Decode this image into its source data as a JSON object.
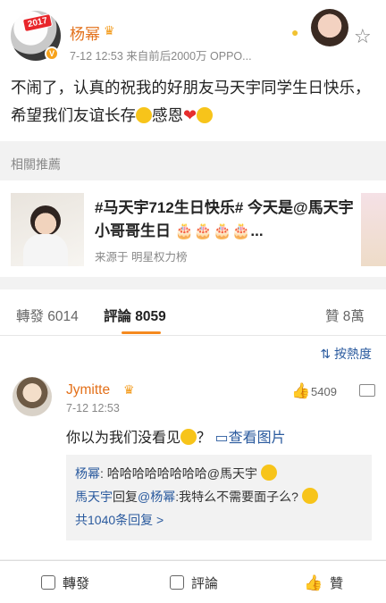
{
  "post": {
    "badge": "2017",
    "author": "杨幂",
    "meta": "7-12 12:53  来自前后2000万 OPPO...",
    "text": "不闹了，认真的祝我的好朋友马天宇同学生日快乐，希望我们友谊长存",
    "text_tail": "感恩"
  },
  "related": {
    "heading": "相關推薦",
    "card_title": "#马天宇712生日快乐# 今天是@馬天宇 小哥哥生日",
    "card_source": "来源于 明星权力榜"
  },
  "tabs": {
    "repost": "轉發 6014",
    "comments": "評論 8059",
    "likes": "贊 8萬"
  },
  "comments": {
    "sort_label": "按熱度",
    "author": "Jymitte",
    "time": "7-12 12:53",
    "likes": "5409",
    "text": "你以为我们没看见",
    "question": "？",
    "view_image": "查看图片",
    "reply1_user": "杨幂",
    "reply1_text": ": 哈哈哈哈哈哈哈哈@馬天宇",
    "reply2_user": "馬天宇",
    "reply2_mid": "回复",
    "reply2_target": "@杨幂",
    "reply2_text": ":我特么不需要面子么?",
    "more_replies": "共1040条回复 >"
  },
  "bottom_bar": {
    "repost": "轉發",
    "comment": "評論",
    "like": "贊"
  },
  "colors": {
    "accent_orange": "#f58a1f",
    "name_orange": "#e3701a",
    "link_blue": "#2a5a9e"
  }
}
